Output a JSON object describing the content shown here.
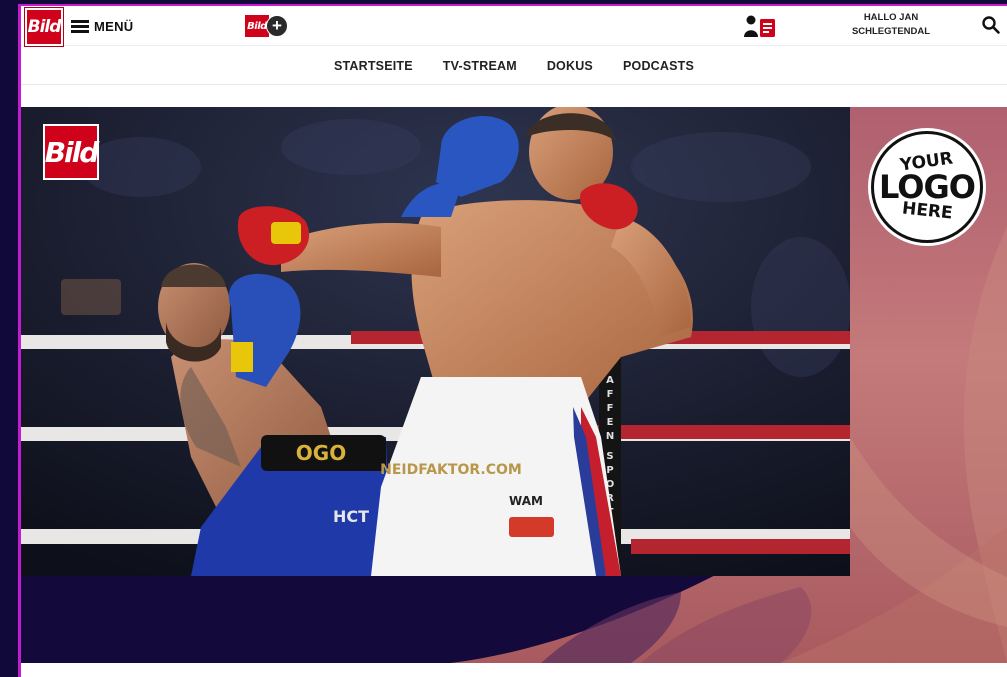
{
  "header": {
    "logo_text": "Bild",
    "menu_label": "MENÜ",
    "bildplus_logo_text": "Bild",
    "bildplus_plus": "+",
    "greeting_line1": "HALLO JAN",
    "greeting_line2": "SCHLEGTENDAL"
  },
  "nav": {
    "items": [
      "STARTSEITE",
      "TV-STREAM",
      "DOKUS",
      "PODCASTS"
    ]
  },
  "hero": {
    "watermark_logo": "Bild",
    "photo_texts": {
      "trunks_left": "OGO",
      "trunks_right": "NEIDFAKTOR.COM",
      "sponsor_hct": "HCT",
      "sponsor_wam": "WAM",
      "pole_text": "PAFFEN SPORT"
    }
  },
  "placeholder_logo": {
    "line1": "YOUR",
    "line2": "LOGO",
    "line3": "HERE"
  },
  "colors": {
    "brand_red": "#d0021b",
    "frame_magenta": "#c21bd0",
    "stage_navy": "#14093b"
  }
}
